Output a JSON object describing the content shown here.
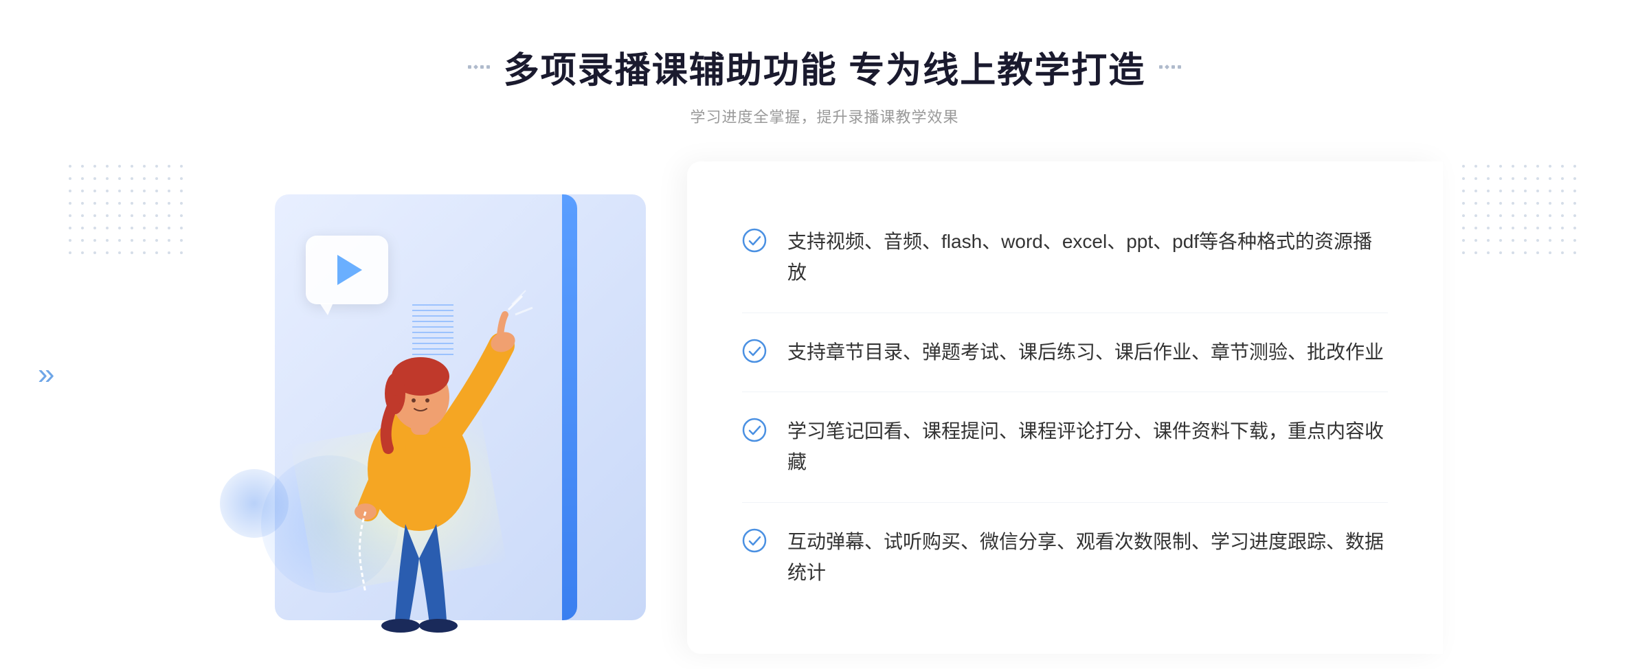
{
  "header": {
    "title": "多项录播课辅助功能 专为线上教学打造",
    "subtitle": "学习进度全掌握，提升录播课教学效果"
  },
  "features": [
    {
      "id": "feature-1",
      "text": "支持视频、音频、flash、word、excel、ppt、pdf等各种格式的资源播放"
    },
    {
      "id": "feature-2",
      "text": "支持章节目录、弹题考试、课后练习、课后作业、章节测验、批改作业"
    },
    {
      "id": "feature-3",
      "text": "学习笔记回看、课程提问、课程评论打分、课件资料下载，重点内容收藏"
    },
    {
      "id": "feature-4",
      "text": "互动弹幕、试听购买、微信分享、观看次数限制、学习进度跟踪、数据统计"
    }
  ],
  "decorations": {
    "chevron_left": "»"
  }
}
